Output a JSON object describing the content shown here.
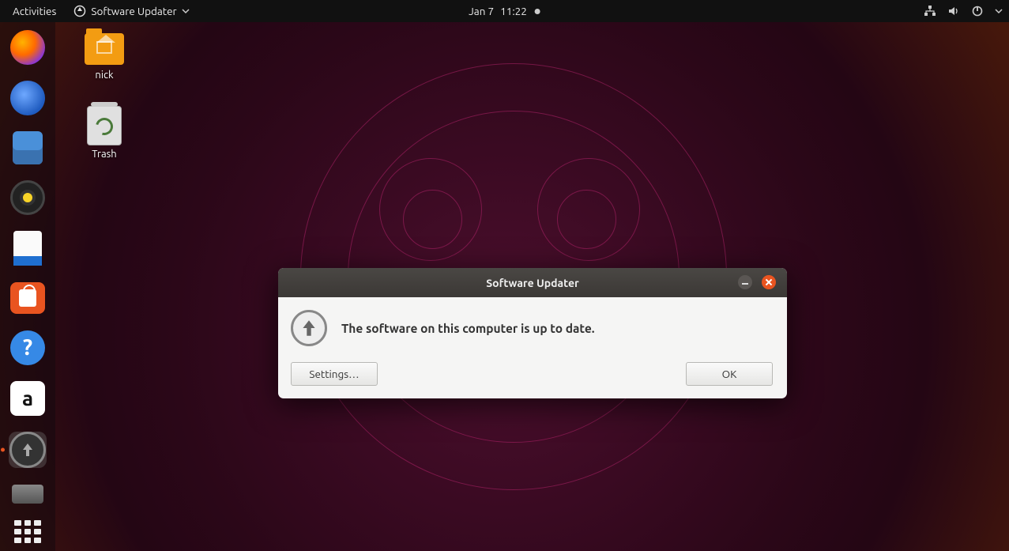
{
  "topbar": {
    "activities": "Activities",
    "app_menu": "Software Updater",
    "date": "Jan 7",
    "time": "11:22"
  },
  "dock": {
    "items": [
      {
        "name": "firefox",
        "label": "Firefox"
      },
      {
        "name": "thunderbird",
        "label": "Thunderbird"
      },
      {
        "name": "files",
        "label": "Files"
      },
      {
        "name": "rhythmbox",
        "label": "Rhythmbox"
      },
      {
        "name": "writer",
        "label": "LibreOffice Writer"
      },
      {
        "name": "software",
        "label": "Ubuntu Software"
      },
      {
        "name": "help",
        "label": "Help"
      },
      {
        "name": "amazon",
        "label": "Amazon"
      },
      {
        "name": "updater",
        "label": "Software Updater",
        "running": true,
        "active": true
      },
      {
        "name": "disks",
        "label": "Disks"
      }
    ],
    "show_apps": "Show Applications"
  },
  "desktop": {
    "home_label": "nick",
    "trash_label": "Trash"
  },
  "dialog": {
    "title": "Software Updater",
    "message": "The software on this computer is up to date.",
    "settings_label": "Settings…",
    "ok_label": "OK"
  }
}
